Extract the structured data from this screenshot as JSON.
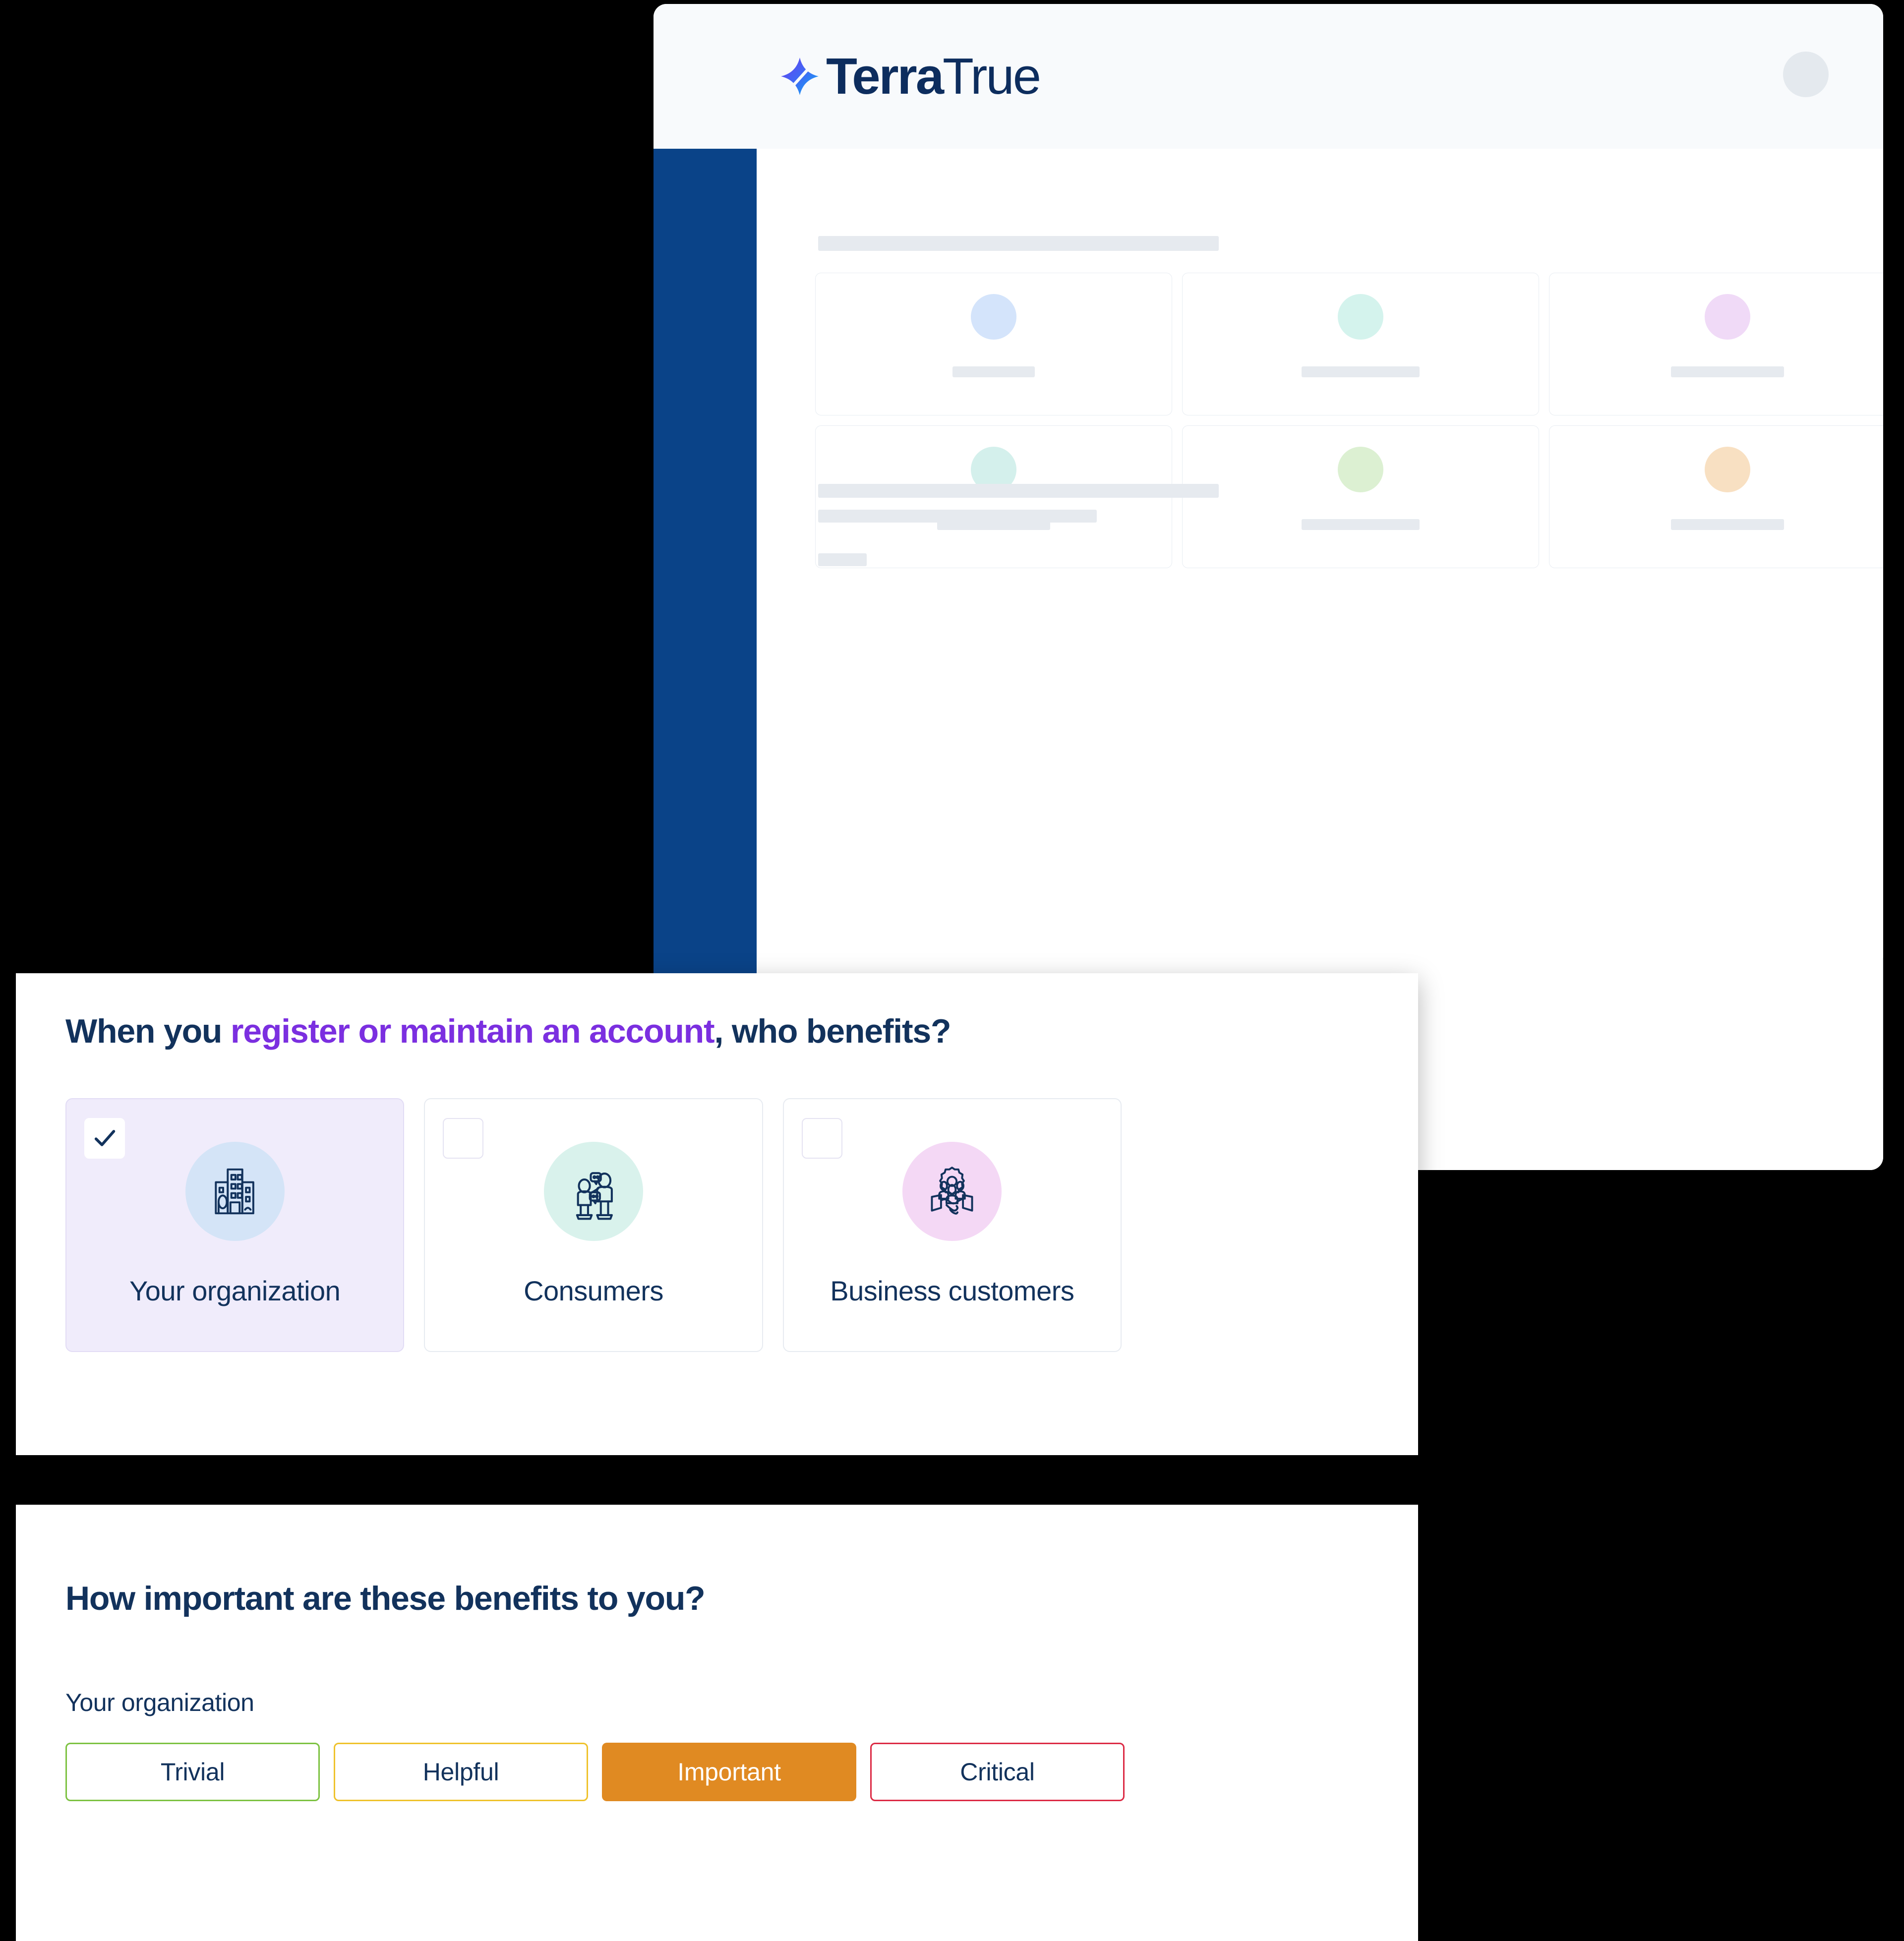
{
  "app": {
    "logo": {
      "mark_icon": "terratrue-star-icon",
      "text_bold": "Terra",
      "text_light": "True",
      "gradient_start": "#6b3cf0",
      "gradient_end": "#0cb4f0"
    },
    "avatar_icon": "user-avatar-placeholder",
    "sidebar_color": "#0a4388",
    "skeleton_cards": [
      {
        "circle_color": "#d4e4fb",
        "label_width": 166
      },
      {
        "circle_color": "#d4f3ed",
        "label_width": 238
      },
      {
        "circle_color": "#f0daf7",
        "label_width": 228
      },
      {
        "circle_color": "#d4f0ec",
        "label_width": 228
      },
      {
        "circle_color": "#dcf0d2",
        "label_width": 238
      },
      {
        "circle_color": "#f8e0c2",
        "label_width": 228
      }
    ],
    "bottom_card_bars": [
      {
        "color": "#d6edd4",
        "width": 126
      },
      {
        "color": "#f7eec9",
        "width": 146
      },
      {
        "color": "#f9e2ca",
        "width": 142
      },
      {
        "color": "#f7cfcf",
        "width": 146
      }
    ]
  },
  "benefits_panel": {
    "question_prefix": "When you ",
    "question_highlight": "register or maintain an account",
    "question_suffix": ", who benefits?",
    "highlight_color": "#7b2fe0",
    "options": [
      {
        "label": "Your organization",
        "icon": "office-buildings-icon",
        "circle_color": "#d4e4f7",
        "selected": true,
        "checkbox_icon": "checkmark-icon"
      },
      {
        "label": "Consumers",
        "icon": "two-people-icon",
        "circle_color": "#d9f2ec",
        "selected": false,
        "checkbox_icon": "empty-checkbox-icon"
      },
      {
        "label": "Business customers",
        "icon": "handshake-gear-people-icon",
        "circle_color": "#f4d8f5",
        "selected": false,
        "checkbox_icon": "empty-checkbox-icon"
      }
    ]
  },
  "importance_panel": {
    "question": "How important are these benefits to you?",
    "subject": "Your organization",
    "ratings": [
      {
        "label": "Trivial",
        "color": "#7dc242",
        "selected": false
      },
      {
        "label": "Helpful",
        "color": "#efc22c",
        "selected": false
      },
      {
        "label": "Important",
        "color": "#e08a22",
        "selected": true
      },
      {
        "label": "Critical",
        "color": "#dc2b45",
        "selected": false
      }
    ]
  }
}
